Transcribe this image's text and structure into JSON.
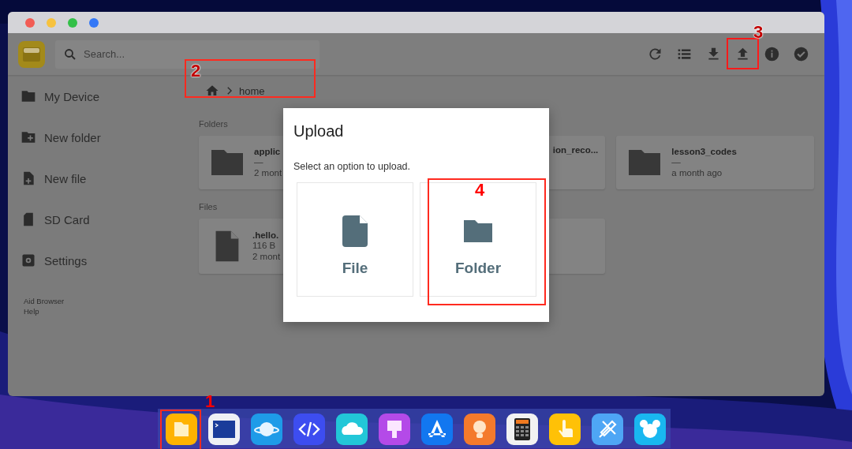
{
  "search": {
    "placeholder": "Search..."
  },
  "toolbar": [
    {
      "kind": "reload"
    },
    {
      "kind": "list"
    },
    {
      "kind": "download"
    },
    {
      "kind": "upload",
      "annotation": "3"
    },
    {
      "kind": "info"
    },
    {
      "kind": "check"
    }
  ],
  "sidebar": {
    "items": [
      {
        "kind": "device",
        "label": "My Device"
      },
      {
        "kind": "new-folder",
        "label": "New folder"
      },
      {
        "kind": "new-file",
        "label": "New file"
      },
      {
        "kind": "sd-card",
        "label": "SD Card"
      },
      {
        "kind": "settings",
        "label": "Settings"
      }
    ],
    "footer": [
      "Aid Browser",
      "Help"
    ]
  },
  "breadcrumb": {
    "annotation": "2",
    "items": [
      "home"
    ]
  },
  "folders": {
    "label": "Folders",
    "items": [
      {
        "name": "applic",
        "size": "—",
        "modified": "2 mont"
      },
      {
        "name": "ion_reco..."
      },
      {
        "name": "lesson3_codes",
        "size": "—",
        "modified": "a month ago"
      }
    ]
  },
  "files": {
    "label": "Files",
    "items": [
      {
        "name": ".hello.",
        "size": "116 B",
        "modified": "2 mont"
      }
    ]
  },
  "dialog": {
    "title": "Upload",
    "message": "Select an option to upload.",
    "options": [
      {
        "kind": "file",
        "label": "File"
      },
      {
        "kind": "folder",
        "label": "Folder",
        "annotation": "4"
      }
    ]
  },
  "dock": {
    "annotation": "1"
  }
}
